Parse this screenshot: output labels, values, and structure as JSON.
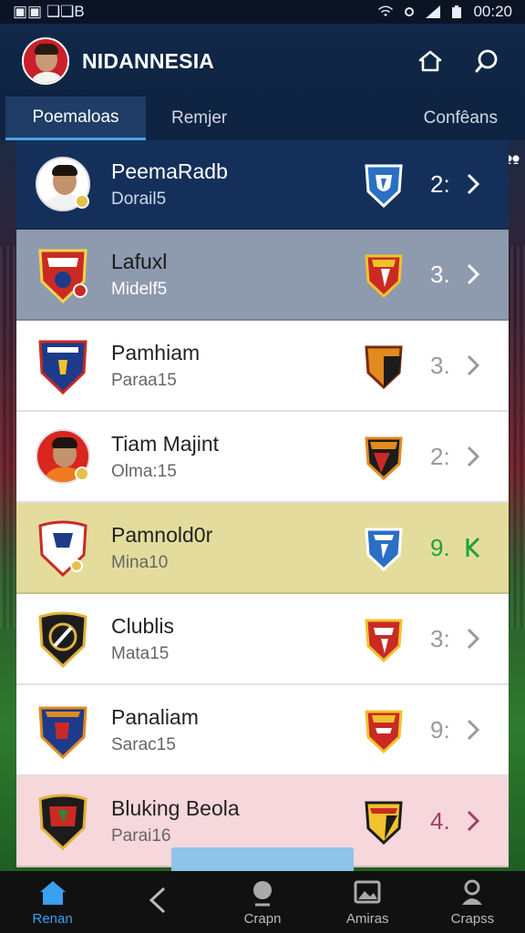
{
  "status": {
    "left": "▣▣ ❑❑B",
    "time": "00:20"
  },
  "header": {
    "title": "NIDANNESIA"
  },
  "tabs": [
    {
      "label": "Poemaloas",
      "active": true
    },
    {
      "label": "Remjer",
      "active": false
    },
    {
      "label": "Confêans",
      "active": false
    }
  ],
  "rows": [
    {
      "name": "PeemaRadb",
      "sub": "Dorail5",
      "score": "2:",
      "crest": "player",
      "opp_color": "#2a6fc4"
    },
    {
      "name": "Lafuxl",
      "sub": "Midelf5",
      "score": "3.",
      "crest": "red-shield",
      "opp_color": "#c92a24"
    },
    {
      "name": "Pamhiam",
      "sub": "Paraa15",
      "score": "3.",
      "crest": "blue-shield",
      "opp_color": "#e28a1f"
    },
    {
      "name": "Tiam Majint",
      "sub": "Olma:15",
      "score": "2:",
      "crest": "player-red",
      "opp_color": "#1c1c1c"
    },
    {
      "name": "Pamnold0r",
      "sub": "Mina10",
      "score": "9.",
      "crest": "white-shield",
      "opp_color": "#2a6fc4"
    },
    {
      "name": "Clublis",
      "sub": "Mata15",
      "score": "3:",
      "crest": "black-gold",
      "opp_color": "#c92a24"
    },
    {
      "name": "Panaliam",
      "sub": "Sarac15",
      "score": "9:",
      "crest": "navy-red",
      "opp_color": "#c92a24"
    },
    {
      "name": "Bluking Beola",
      "sub": "Parai16",
      "score": "4.",
      "crest": "black-red",
      "opp_color": "#1c1c1c"
    }
  ],
  "nav": [
    {
      "label": "Renan",
      "icon": "home-icon",
      "active": true
    },
    {
      "label": "",
      "icon": "back-icon",
      "active": false
    },
    {
      "label": "Crapn",
      "icon": "ball-icon",
      "active": false
    },
    {
      "label": "Amiras",
      "icon": "photo-icon",
      "active": false
    },
    {
      "label": "Crapss",
      "icon": "person-icon",
      "active": false
    }
  ],
  "colors": {
    "accent": "#3aa0f0",
    "header": "#12284a",
    "highlight_row": "#e4dc9c",
    "pink_row": "#f6d7db"
  }
}
